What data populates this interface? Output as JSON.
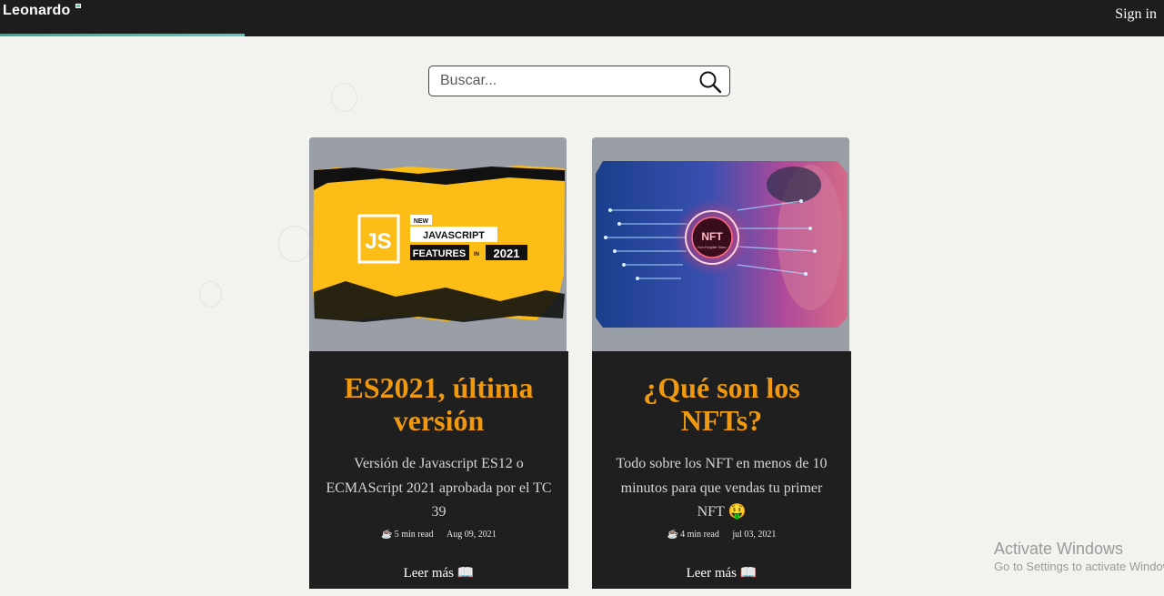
{
  "header": {
    "brand": "Leonardo",
    "sign_in": "Sign in",
    "reading_progress": 0.21
  },
  "search": {
    "placeholder": "Buscar..."
  },
  "posts": [
    {
      "title": "ES2021, última versión",
      "description": "Versión de Javascript ES12 o ECMAScript 2021 aprobada por el TC 39",
      "read_time": "5 min read",
      "date": "Aug 09, 2021",
      "link": "Leer más 📖",
      "image": {
        "badge_text": "JS",
        "tag_new": "NEW",
        "line1": "JAVASCRIPT",
        "line2": "FEATURES",
        "line2_in": "IN",
        "year": "2021"
      }
    },
    {
      "title": "¿Qué son los NFTs?",
      "description": "Todo sobre los NFT en menos de 10 minutos para que vendas tu primer NFT 🤑",
      "read_time": "4 min read",
      "date": "jul 03, 2021",
      "link": "Leer más 📖",
      "image": {
        "badge_text": "NFT",
        "badge_sub": "Non-Fungible Token"
      }
    }
  ],
  "os_watermark": {
    "line1": "Activate Windows",
    "line2": "Go to Settings to activate Windows."
  },
  "colors": {
    "topbar": "#1d1d1d",
    "accent_title": "#f0990f",
    "card_body": "#1f1f1f",
    "page_bg": "#f2f2ef"
  }
}
